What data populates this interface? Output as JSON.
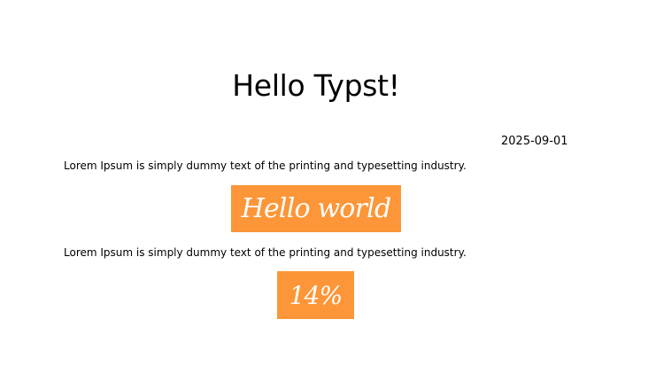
{
  "document": {
    "title": "Hello Typst!",
    "date": "2025-09-01",
    "paragraph_1": "Lorem Ipsum is simply dummy text of the printing and typesetting industry.",
    "highlight_1": "Hello world",
    "paragraph_2": "Lorem Ipsum is simply dummy text of the printing and typesetting industry.",
    "highlight_2": "14%"
  },
  "colors": {
    "accent": "#fd9638",
    "accent_text": "#ffffff",
    "body_text": "#000000",
    "background": "#ffffff"
  }
}
